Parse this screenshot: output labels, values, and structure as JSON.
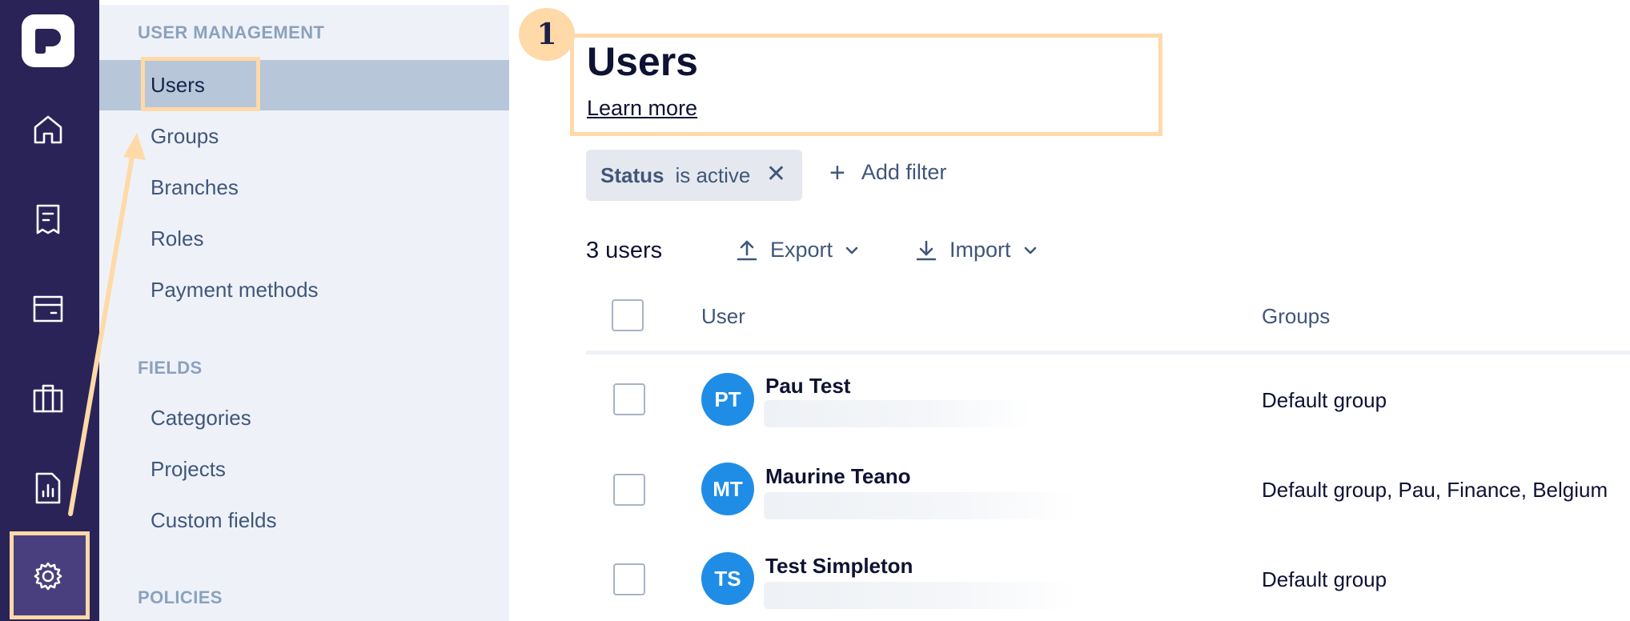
{
  "colors": {
    "rail_bg": "#2a2358",
    "subnav_bg": "#eef2f8",
    "active_nav_bg": "#b8c6d9",
    "highlight": "#ffd9a8",
    "avatar_bg": "#1f8de6"
  },
  "rail": {
    "icons": [
      "logo-icon",
      "home-icon",
      "receipt-icon",
      "card-icon",
      "briefcase-icon",
      "report-icon",
      "settings-gear-icon"
    ],
    "active": "settings-gear-icon"
  },
  "subnav": {
    "sections": [
      {
        "title": "USER MANAGEMENT",
        "items": [
          "Users",
          "Groups",
          "Branches",
          "Roles",
          "Payment methods"
        ]
      },
      {
        "title": "FIELDS",
        "items": [
          "Categories",
          "Projects",
          "Custom fields"
        ]
      },
      {
        "title": "POLICIES",
        "items": []
      }
    ],
    "active_item": "Users"
  },
  "annotation": {
    "step": "1"
  },
  "header": {
    "title": "Users",
    "learn_more": "Learn more"
  },
  "filters": {
    "chip_key": "Status",
    "chip_value": "is active",
    "add_label": "Add filter"
  },
  "toolbar": {
    "count": "3 users",
    "export_label": "Export",
    "import_label": "Import"
  },
  "table": {
    "columns": [
      "User",
      "Groups"
    ],
    "rows": [
      {
        "initials": "PT",
        "name": "Pau Test",
        "groups": "Default group"
      },
      {
        "initials": "MT",
        "name": "Maurine Teano",
        "groups": "Default group, Pau, Finance, Belgium"
      },
      {
        "initials": "TS",
        "name": "Test Simpleton",
        "groups": "Default group"
      }
    ]
  }
}
